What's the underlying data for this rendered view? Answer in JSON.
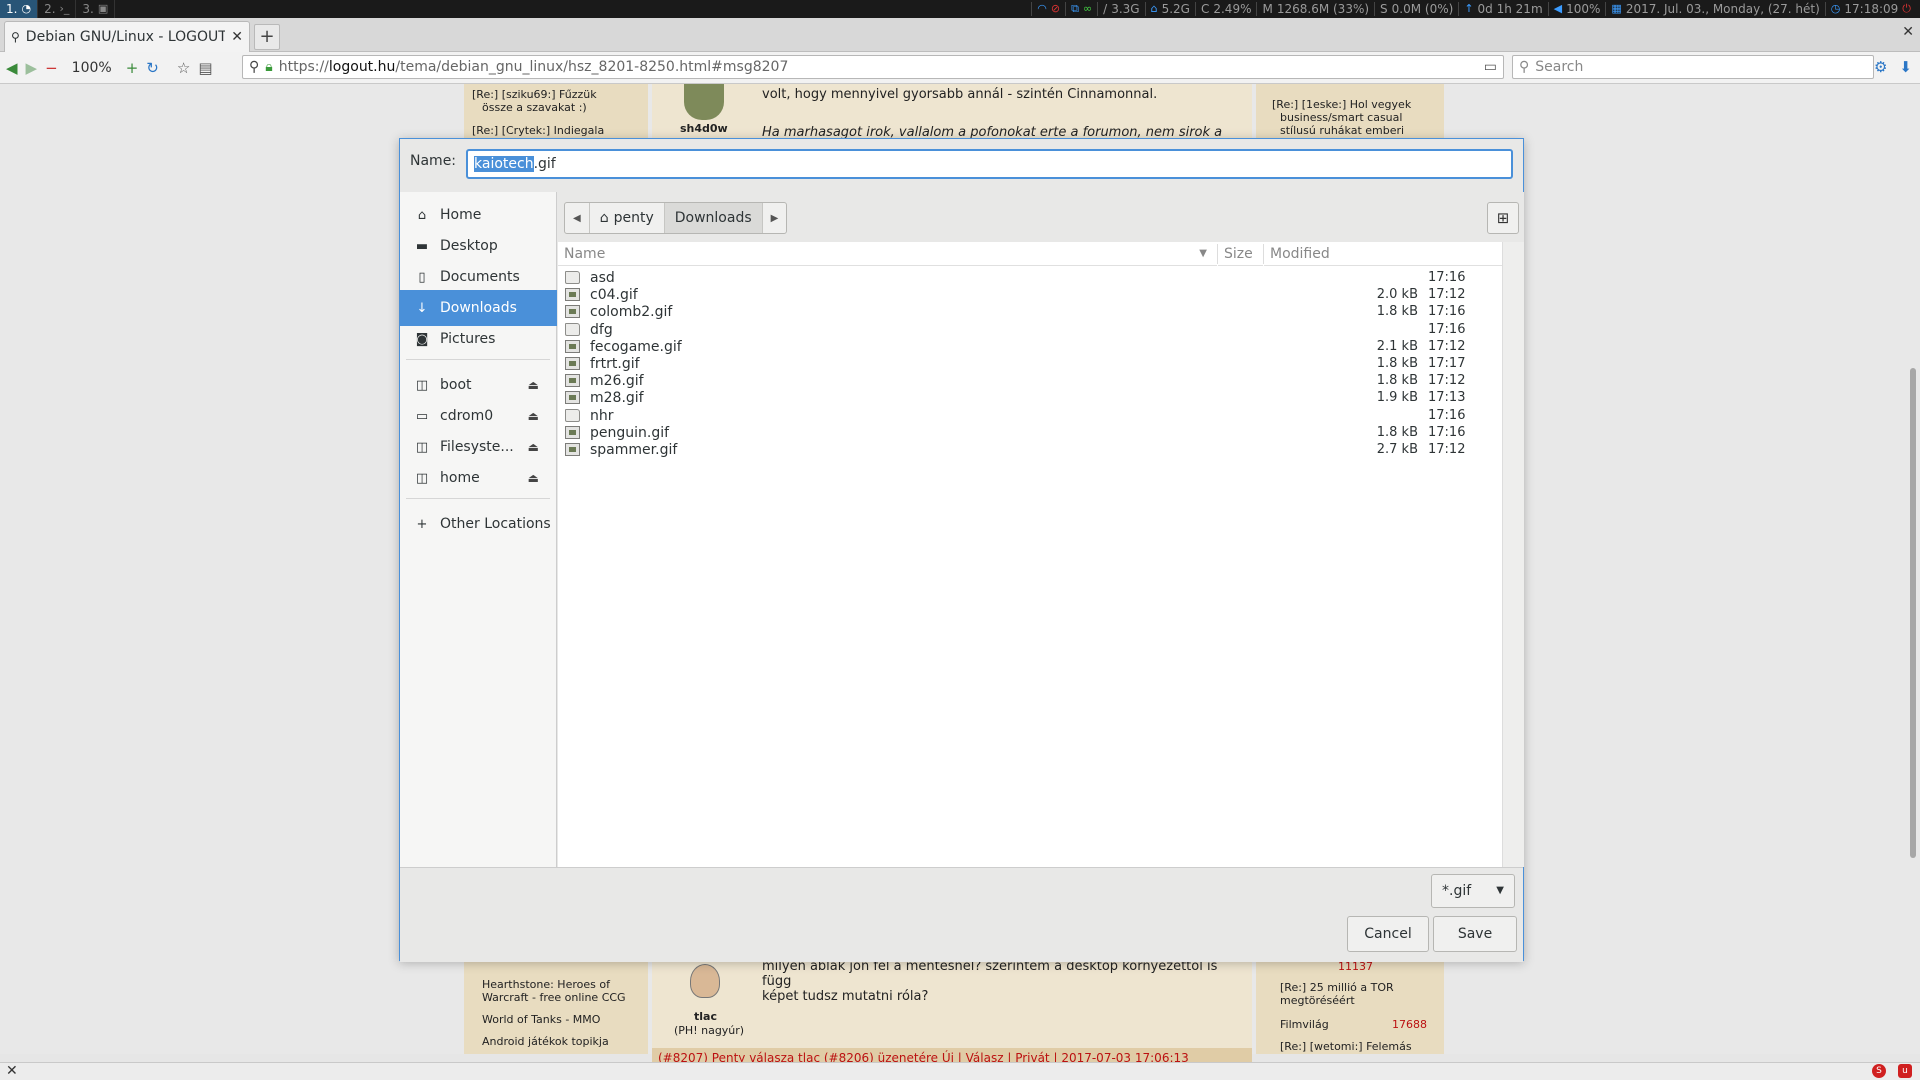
{
  "sysbar": {
    "workspaces": [
      {
        "label": "1.",
        "icon": "clock-glyph-icon",
        "glyph": "◔",
        "active": true
      },
      {
        "label": "2.",
        "icon": "terminal-icon",
        "glyph": "›_",
        "active": false
      },
      {
        "label": "3.",
        "icon": "image-icon",
        "glyph": "▣",
        "active": false
      }
    ],
    "status": {
      "mem_swap": "3.3G",
      "home_free": "5.2G",
      "cpu_label": "C",
      "cpu": "2.49%",
      "mem_label": "M",
      "mem": "1268.6M (33%)",
      "swap_label": "S",
      "swap": "0.0M (0%)",
      "uptime": "0d 1h 21m",
      "volume": "100%",
      "date": "2017. Jul. 03., Monday, (27. hét)",
      "time": "17:18:09"
    }
  },
  "browser": {
    "tab_title": "Debian GNU/Linux - LOGOUT....",
    "zoom": "100%",
    "url_prefix": "https://",
    "url_domain": "logout.hu",
    "url_path": "/tema/debian_gnu_linux/hsz_8201-8250.html#msg8207",
    "search_placeholder": "Search"
  },
  "background_page": {
    "left_items": [
      "[Re:] [sziku69:] Fűzzük",
      "össze a szavakat :)",
      "[Re:] [Crytek:] Indiegala"
    ],
    "left_items_bottom": [
      "Hearthstone: Heroes of",
      "Warcraft - free online CCG",
      "World of Tanks - MMO",
      "Android játékok topikja"
    ],
    "user_top": "sh4d0w",
    "post_top_line1": "volt, hogy mennyivel gyorsabb annál - szintén Cinnamonnal.",
    "post_top_line2": "Ha marhasagot irok, vallalom a pofonokat erte a forumon, nem sirok a",
    "user_bottom": "tlac",
    "user_bottom_rank": "(PH! nagyúr)",
    "post_bottom_line1": "milyen ablak jön fel a mentésnél? szerintem a desktop környezettől is",
    "post_bottom_line2": "függ",
    "post_bottom_line3": "képet tudsz mutatni róla?",
    "right_items": [
      "[Re:] [1eske:] Hol vegyek",
      "business/smart casual",
      "stílusú ruhákat emberi"
    ],
    "right_items_bottom": [
      "11137",
      "[Re:] 25 millió a TOR",
      "megtöréséért",
      "Filmvilág",
      "17688",
      "[Re:] [wetomi:] Felemás"
    ],
    "footer_strip": "(#8207) Penty válasza tlac (#8206) üzenetére           Új | Válasz | Privát | 2017-07-03 17:06:13"
  },
  "dialog": {
    "name_label": "Name:",
    "filename_selected": "kaiotech",
    "filename_ext": ".gif",
    "sidebar": {
      "places": [
        {
          "label": "Home",
          "icon": "home-icon",
          "glyph": "⌂"
        },
        {
          "label": "Desktop",
          "icon": "folder-icon",
          "glyph": "▬"
        },
        {
          "label": "Documents",
          "icon": "document-icon",
          "glyph": "▯"
        },
        {
          "label": "Downloads",
          "icon": "download-icon",
          "glyph": "↓"
        },
        {
          "label": "Pictures",
          "icon": "camera-icon",
          "glyph": "◙"
        }
      ],
      "devices": [
        {
          "label": "boot",
          "icon": "drive-icon",
          "glyph": "◫"
        },
        {
          "label": "cdrom0",
          "icon": "optical-drive-icon",
          "glyph": "▭"
        },
        {
          "label": "Filesyste...",
          "icon": "drive-icon",
          "glyph": "◫"
        },
        {
          "label": "home",
          "icon": "drive-icon",
          "glyph": "◫"
        }
      ],
      "other_locations": "Other Locations",
      "other_glyph": "+"
    },
    "pathbar": {
      "crumb_home": "penty",
      "crumb_current": "Downloads"
    },
    "columns": {
      "name": "Name",
      "size": "Size",
      "modified": "Modified"
    },
    "files": [
      {
        "name": "asd",
        "type": "folder",
        "size": "",
        "modified": "17:16"
      },
      {
        "name": "c04.gif",
        "type": "gif",
        "size": "2.0 kB",
        "modified": "17:12"
      },
      {
        "name": "colomb2.gif",
        "type": "gif",
        "size": "1.8 kB",
        "modified": "17:16"
      },
      {
        "name": "dfg",
        "type": "folder",
        "size": "",
        "modified": "17:16"
      },
      {
        "name": "fecogame.gif",
        "type": "gif",
        "size": "2.1 kB",
        "modified": "17:12"
      },
      {
        "name": "frtrt.gif",
        "type": "gif",
        "size": "1.8 kB",
        "modified": "17:17"
      },
      {
        "name": "m26.gif",
        "type": "gif",
        "size": "1.8 kB",
        "modified": "17:12"
      },
      {
        "name": "m28.gif",
        "type": "gif",
        "size": "1.9 kB",
        "modified": "17:13"
      },
      {
        "name": "nhr",
        "type": "folder",
        "size": "",
        "modified": "17:16"
      },
      {
        "name": "penguin.gif",
        "type": "gif",
        "size": "1.8 kB",
        "modified": "17:16"
      },
      {
        "name": "spammer.gif",
        "type": "gif",
        "size": "2.7 kB",
        "modified": "17:12"
      }
    ],
    "filter": "*.gif",
    "cancel_label": "Cancel",
    "save_label": "Save"
  },
  "colors": {
    "accent": "#4a90d9",
    "page_column": "#e8dcc0",
    "link_red": "#b11111"
  }
}
